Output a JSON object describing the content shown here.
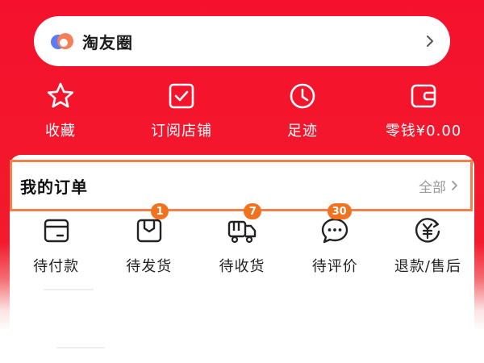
{
  "colors": {
    "brand_red": "#f5112d",
    "badge_orange": "#f2731f",
    "highlight_border": "#f2804a"
  },
  "taoyouquan": {
    "title": "淘友圈",
    "logo_icon": "taoyouquan-logo-icon",
    "arrow_icon": "chevron-right-icon"
  },
  "quick_links": [
    {
      "label": "收藏",
      "icon": "star-icon"
    },
    {
      "label": "订阅店铺",
      "icon": "checkbox-icon"
    },
    {
      "label": "足迹",
      "icon": "clock-icon"
    },
    {
      "label": "零钱¥0.00",
      "icon": "wallet-icon"
    }
  ],
  "orders": {
    "title": "我的订单",
    "all_label": "全部",
    "items": [
      {
        "label": "待付款",
        "icon": "card-icon",
        "badge": ""
      },
      {
        "label": "待发货",
        "icon": "package-icon",
        "badge": "1"
      },
      {
        "label": "待收货",
        "icon": "truck-icon",
        "badge": "7"
      },
      {
        "label": "待评价",
        "icon": "chat-bubble-icon",
        "badge": "30"
      },
      {
        "label": "退款/售后",
        "icon": "refund-icon",
        "badge": ""
      }
    ]
  }
}
